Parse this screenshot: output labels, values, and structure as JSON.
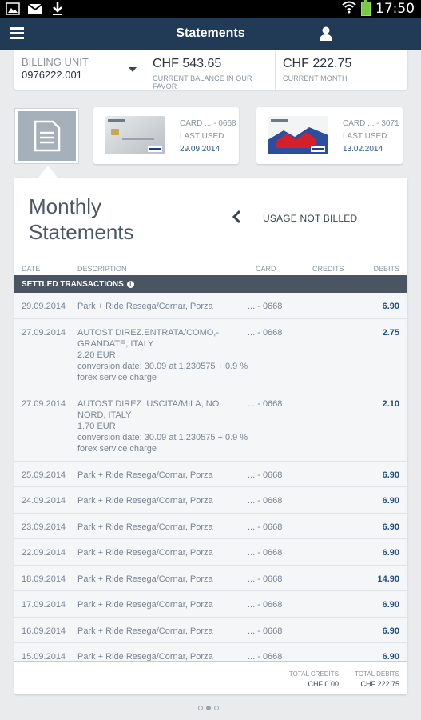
{
  "statusbar": {
    "time": "17:50"
  },
  "header": {
    "title": "Statements"
  },
  "summary": {
    "billing_label": "BILLING UNIT",
    "billing_number": "0976222.001",
    "balance_amount": "CHF 543.65",
    "balance_label": "CURRENT BALANCE IN OUR FAVOR",
    "month_amount": "CHF 222.75",
    "month_label": "CURRENT MONTH"
  },
  "cards": [
    {
      "number": "CARD ... - 0668",
      "last_used_label": "LAST USED",
      "last_used": "29.09.2014"
    },
    {
      "number": "CARD ... - 3071",
      "last_used_label": "LAST USED",
      "last_used": "13.02.2014"
    }
  ],
  "panel": {
    "title": "Monthly Statements",
    "unbilled_label": "USAGE NOT BILLED",
    "columns": {
      "date": "DATE",
      "description": "DESCRIPTION",
      "card": "CARD",
      "credits": "CREDITS",
      "debits": "DEBITS"
    },
    "section_label": "SETTLED TRANSACTIONS"
  },
  "transactions": [
    {
      "date": "29.09.2014",
      "desc": "Park + Ride Resega/Cornar, Porza",
      "card": "... - 0668",
      "debit": "6.90"
    },
    {
      "date": "27.09.2014",
      "desc": "AUTOST DIREZ.ENTRATA/COMO,-GRANDATE, ITALY\n2.20 EUR\nconversion date: 30.09 at 1.230575 + 0.9 % forex service charge",
      "card": "... - 0668",
      "debit": "2.75"
    },
    {
      "date": "27.09.2014",
      "desc": "AUTOST DIREZ. USCITA/MILA, NO NORD, ITALY\n1.70 EUR\nconversion date: 30.09 at 1.230575 + 0.9 % forex service charge",
      "card": "... - 0668",
      "debit": "2.10"
    },
    {
      "date": "25.09.2014",
      "desc": "Park + Ride Resega/Cornar, Porza",
      "card": "... - 0668",
      "debit": "6.90"
    },
    {
      "date": "24.09.2014",
      "desc": "Park + Ride Resega/Cornar, Porza",
      "card": "... - 0668",
      "debit": "6.90"
    },
    {
      "date": "23.09.2014",
      "desc": "Park + Ride Resega/Cornar, Porza",
      "card": "... - 0668",
      "debit": "6.90"
    },
    {
      "date": "22.09.2014",
      "desc": "Park + Ride Resega/Cornar, Porza",
      "card": "... - 0668",
      "debit": "6.90"
    },
    {
      "date": "18.09.2014",
      "desc": "Park + Ride Resega/Cornar, Porza",
      "card": "... - 0668",
      "debit": "14.90"
    },
    {
      "date": "17.09.2014",
      "desc": "Park + Ride Resega/Cornar, Porza",
      "card": "... - 0668",
      "debit": "6.90"
    },
    {
      "date": "16.09.2014",
      "desc": "Park + Ride Resega/Cornar, Porza",
      "card": "... - 0668",
      "debit": "6.90"
    },
    {
      "date": "15.09.2014",
      "desc": "Park + Ride Resega/Cornar, Porza",
      "card": "... - 0668",
      "debit": "6.90"
    }
  ],
  "totals": {
    "credits_label": "TOTAL CREDITS",
    "credits_value": "CHF 0.00",
    "debits_label": "TOTAL DEBITS",
    "debits_value": "CHF 222.75"
  },
  "colors": {
    "header_bg": "#213a56",
    "debit_text": "#1f4f86",
    "section_bar": "#4b5561"
  }
}
